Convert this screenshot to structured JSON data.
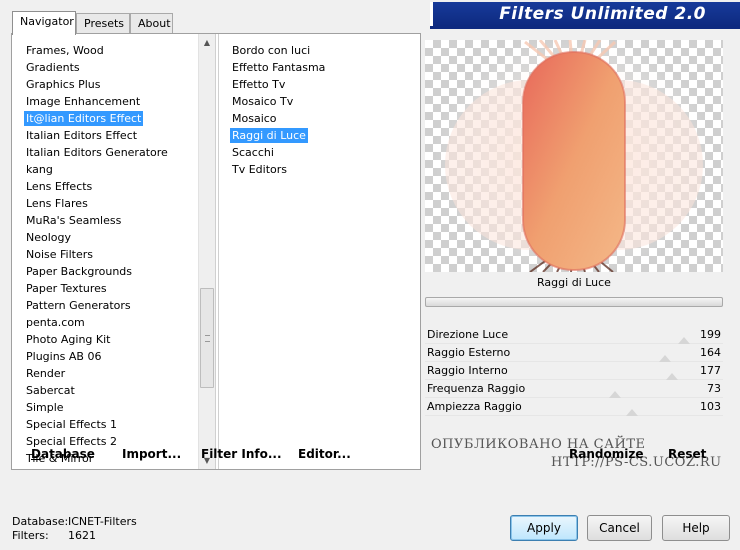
{
  "tabs": [
    "Navigator",
    "Presets",
    "About"
  ],
  "banner": {
    "title": "Filters Unlimited 2.0"
  },
  "categories": [
    "Frames, Wood",
    "Gradients",
    "Graphics Plus",
    "Image Enhancement",
    "It@lian Editors Effect",
    "Italian Editors Effect",
    "Italian Editors Generatore",
    "kang",
    "Lens Effects",
    "Lens Flares",
    "MuRa's Seamless",
    "Neology",
    "Noise Filters",
    "Paper Backgrounds",
    "Paper Textures",
    "Pattern Generators",
    "penta.com",
    "Photo Aging Kit",
    "Plugins AB 06",
    "Render",
    "Sabercat",
    "Simple",
    "Special Effects 1",
    "Special Effects 2",
    "Tile & Mirror"
  ],
  "selected_category": "It@lian Editors Effect",
  "filters": [
    "Bordo con luci",
    "Effetto Fantasma",
    "Effetto Tv",
    "Mosaico Tv",
    "Mosaico",
    "Raggi di Luce",
    "Scacchi",
    "Tv Editors"
  ],
  "selected_filter": "Raggi di Luce",
  "left_buttons": {
    "database": "Database",
    "import": "Import...",
    "filter_info": "Filter Info...",
    "editor": "Editor..."
  },
  "preview": {
    "filter_name": "Raggi di Luce"
  },
  "params": [
    {
      "name": "Direzione Luce",
      "value": "199",
      "level": 199
    },
    {
      "name": "Raggio Esterno",
      "value": "164",
      "level": 164
    },
    {
      "name": "Raggio Interno",
      "value": "177",
      "level": 177
    },
    {
      "name": "Frequenza Raggio",
      "value": "73",
      "level": 73
    },
    {
      "name": "Ampiezza Raggio",
      "value": "103",
      "level": 103
    }
  ],
  "watermark": {
    "line1": "ОПУБЛИКОВАНО   НА САЙТЕ",
    "line2": "HTTP://PS-CS.UCOZ.RU"
  },
  "right_buttons": {
    "randomize": "Randomize",
    "reset": "Reset"
  },
  "status": {
    "database_label": "Database:",
    "database_value": "ICNET-Filters",
    "filters_label": "Filters:",
    "filters_value": "1621"
  },
  "dialog_buttons": {
    "apply": "Apply",
    "cancel": "Cancel",
    "help": "Help"
  },
  "colors": {
    "selection": "#3399ff",
    "banner": "#173a9a"
  }
}
